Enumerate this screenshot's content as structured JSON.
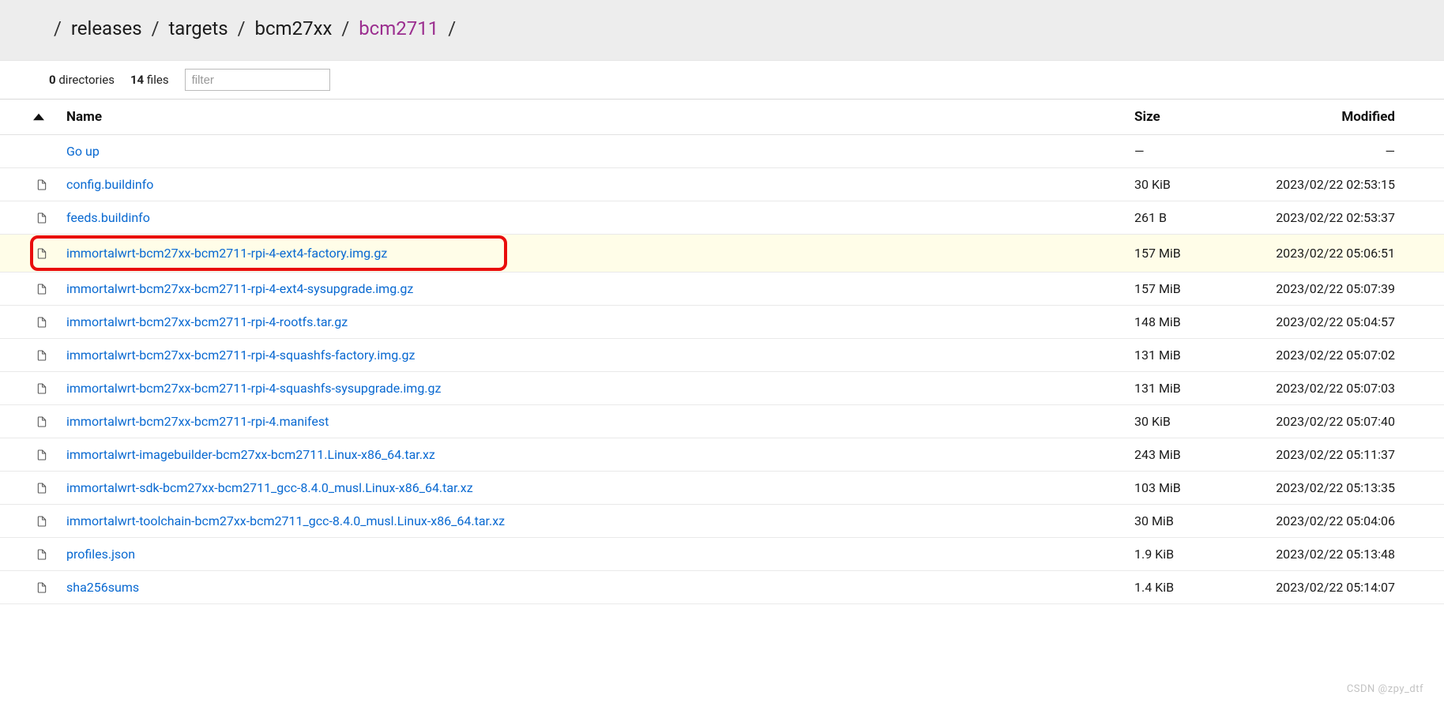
{
  "breadcrumb": {
    "parts": [
      "releases",
      "targets",
      "bcm27xx",
      "bcm2711"
    ]
  },
  "stats": {
    "dir_count": "0",
    "dir_label": "directories",
    "file_count": "14",
    "file_label": "files",
    "filter_placeholder": "filter"
  },
  "columns": {
    "name": "Name",
    "size": "Size",
    "modified": "Modified"
  },
  "go_up_label": "Go up",
  "dash": "—",
  "files": [
    {
      "name": "config.buildinfo",
      "size": "30 KiB",
      "modified": "2023/02/22 02:53:15",
      "highlighted": false
    },
    {
      "name": "feeds.buildinfo",
      "size": "261 B",
      "modified": "2023/02/22 02:53:37",
      "highlighted": false
    },
    {
      "name": "immortalwrt-bcm27xx-bcm2711-rpi-4-ext4-factory.img.gz",
      "size": "157 MiB",
      "modified": "2023/02/22 05:06:51",
      "highlighted": true
    },
    {
      "name": "immortalwrt-bcm27xx-bcm2711-rpi-4-ext4-sysupgrade.img.gz",
      "size": "157 MiB",
      "modified": "2023/02/22 05:07:39",
      "highlighted": false
    },
    {
      "name": "immortalwrt-bcm27xx-bcm2711-rpi-4-rootfs.tar.gz",
      "size": "148 MiB",
      "modified": "2023/02/22 05:04:57",
      "highlighted": false
    },
    {
      "name": "immortalwrt-bcm27xx-bcm2711-rpi-4-squashfs-factory.img.gz",
      "size": "131 MiB",
      "modified": "2023/02/22 05:07:02",
      "highlighted": false
    },
    {
      "name": "immortalwrt-bcm27xx-bcm2711-rpi-4-squashfs-sysupgrade.img.gz",
      "size": "131 MiB",
      "modified": "2023/02/22 05:07:03",
      "highlighted": false
    },
    {
      "name": "immortalwrt-bcm27xx-bcm2711-rpi-4.manifest",
      "size": "30 KiB",
      "modified": "2023/02/22 05:07:40",
      "highlighted": false
    },
    {
      "name": "immortalwrt-imagebuilder-bcm27xx-bcm2711.Linux-x86_64.tar.xz",
      "size": "243 MiB",
      "modified": "2023/02/22 05:11:37",
      "highlighted": false
    },
    {
      "name": "immortalwrt-sdk-bcm27xx-bcm2711_gcc-8.4.0_musl.Linux-x86_64.tar.xz",
      "size": "103 MiB",
      "modified": "2023/02/22 05:13:35",
      "highlighted": false
    },
    {
      "name": "immortalwrt-toolchain-bcm27xx-bcm2711_gcc-8.4.0_musl.Linux-x86_64.tar.xz",
      "size": "30 MiB",
      "modified": "2023/02/22 05:04:06",
      "highlighted": false
    },
    {
      "name": "profiles.json",
      "size": "1.9 KiB",
      "modified": "2023/02/22 05:13:48",
      "highlighted": false
    },
    {
      "name": "sha256sums",
      "size": "1.4 KiB",
      "modified": "2023/02/22 05:14:07",
      "highlighted": false
    }
  ],
  "watermark": "CSDN @zpy_dtf"
}
